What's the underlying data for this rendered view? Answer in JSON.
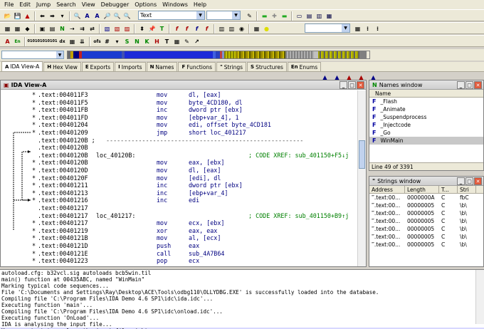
{
  "menu": [
    "File",
    "Edit",
    "Jump",
    "Search",
    "View",
    "Debugger",
    "Options",
    "Windows",
    "Help"
  ],
  "toolbar": {
    "text_combo": "Text"
  },
  "tabs": [
    {
      "icon": "A",
      "label": "IDA View-A",
      "active": true
    },
    {
      "icon": "H",
      "label": "Hex View"
    },
    {
      "icon": "E",
      "label": "Exports"
    },
    {
      "icon": "I",
      "label": "Imports"
    },
    {
      "icon": "N",
      "label": "Names"
    },
    {
      "icon": "F",
      "label": "Functions"
    },
    {
      "icon": "\"",
      "label": "Strings"
    },
    {
      "icon": "S",
      "label": "Structures"
    },
    {
      "icon": "En",
      "label": "Enums"
    }
  ],
  "ida_view": {
    "title": "IDA View-A",
    "rows": [
      {
        "dot": "*",
        "addr": ".text:004011F3",
        "label": "",
        "mnem": "mov",
        "ops": "dl, [eax]",
        "comment": ""
      },
      {
        "dot": "*",
        "addr": ".text:004011F5",
        "label": "",
        "mnem": "mov",
        "ops": "byte_4CD180, dl",
        "comment": ""
      },
      {
        "dot": "*",
        "addr": ".text:004011FB",
        "label": "",
        "mnem": "inc",
        "ops": "dword ptr [ebx]",
        "comment": ""
      },
      {
        "dot": "*",
        "addr": ".text:004011FD",
        "label": "",
        "mnem": "mov",
        "ops": "[ebp+var_4], 1",
        "comment": ""
      },
      {
        "dot": "*",
        "addr": ".text:00401204",
        "label": "",
        "mnem": "mov",
        "ops": "edi, offset byte_4CD181",
        "comment": ""
      },
      {
        "dot": "*",
        "addr": ".text:00401209",
        "label": "",
        "mnem": "jmp",
        "ops": "short loc_401217",
        "comment": ""
      },
      {
        "dot": "",
        "addr": ".text:0040120B ;",
        "label": "",
        "mnem": "",
        "ops": "",
        "comment": "",
        "sep": "-------------------------------------------------------"
      },
      {
        "dot": "",
        "addr": ".text:0040120B",
        "label": "",
        "mnem": "",
        "ops": "",
        "comment": ""
      },
      {
        "dot": "",
        "addr": ".text:0040120B",
        "label": "loc_40120B:",
        "mnem": "",
        "ops": "",
        "comment": "; CODE XREF: sub_401150+F5↓j"
      },
      {
        "dot": "*",
        "addr": ".text:0040120B",
        "label": "",
        "mnem": "mov",
        "ops": "eax, [ebx]",
        "comment": ""
      },
      {
        "dot": "*",
        "addr": ".text:0040120D",
        "label": "",
        "mnem": "mov",
        "ops": "dl, [eax]",
        "comment": ""
      },
      {
        "dot": "*",
        "addr": ".text:0040120F",
        "label": "",
        "mnem": "mov",
        "ops": "[edi], dl",
        "comment": ""
      },
      {
        "dot": "*",
        "addr": ".text:00401211",
        "label": "",
        "mnem": "inc",
        "ops": "dword ptr [ebx]",
        "comment": ""
      },
      {
        "dot": "*",
        "addr": ".text:00401213",
        "label": "",
        "mnem": "inc",
        "ops": "[ebp+var_4]",
        "comment": ""
      },
      {
        "dot": "*",
        "addr": ".text:00401216",
        "label": "",
        "mnem": "inc",
        "ops": "edi",
        "comment": ""
      },
      {
        "dot": "",
        "addr": ".text:00401217",
        "label": "",
        "mnem": "",
        "ops": "",
        "comment": ""
      },
      {
        "dot": "",
        "addr": ".text:00401217",
        "label": "loc_401217:",
        "mnem": "",
        "ops": "",
        "comment": "; CODE XREF: sub_401150+B9↑j"
      },
      {
        "dot": "*",
        "addr": ".text:00401217",
        "label": "",
        "mnem": "mov",
        "ops": "ecx, [ebx]",
        "comment": ""
      },
      {
        "dot": "*",
        "addr": ".text:00401219",
        "label": "",
        "mnem": "xor",
        "ops": "eax, eax",
        "comment": ""
      },
      {
        "dot": "*",
        "addr": ".text:0040121B",
        "label": "",
        "mnem": "mov",
        "ops": "al, [ecx]",
        "comment": ""
      },
      {
        "dot": "*",
        "addr": ".text:0040121D",
        "label": "",
        "mnem": "push",
        "ops": "eax",
        "comment": ""
      },
      {
        "dot": "*",
        "addr": ".text:0040121E",
        "label": "",
        "mnem": "call",
        "ops": "sub_4A7B64",
        "comment": ""
      },
      {
        "dot": "*",
        "addr": ".text:00401223",
        "label": "",
        "mnem": "pop",
        "ops": "ecx",
        "comment": ""
      }
    ]
  },
  "names_window": {
    "title": "Names window",
    "column": "Name",
    "items": [
      {
        "icon": "F",
        "name": "_Flash"
      },
      {
        "icon": "F",
        "name": "_Animate"
      },
      {
        "icon": "F",
        "name": "_Suspendprocess"
      },
      {
        "icon": "F",
        "name": "_Injectcode"
      },
      {
        "icon": "F",
        "name": "_Go"
      },
      {
        "icon": "F",
        "name": "WinMain",
        "selected": true
      }
    ],
    "status": "Line 49 of 3391"
  },
  "strings_window": {
    "title": "Strings window",
    "columns": [
      "Address",
      "Length",
      "T...",
      "Stri"
    ],
    "rows": [
      [
        ".text:00...",
        "0000000A",
        "C",
        "fbC"
      ],
      [
        ".text:00...",
        "00000005",
        "C",
        "\\b\\"
      ],
      [
        ".text:00...",
        "00000005",
        "C",
        "\\b\\"
      ],
      [
        ".text:00...",
        "00000005",
        "C",
        "\\b\\"
      ],
      [
        ".text:00...",
        "00000005",
        "C",
        "\\b\\"
      ],
      [
        ".text:00...",
        "00000005",
        "C",
        "\\b\\"
      ],
      [
        ".text:00...",
        "00000005",
        "C",
        "\\b\\"
      ]
    ]
  },
  "output": [
    "autoload.cfg: b32vcl.sig autoloads bcb5win.til",
    "main() function at 00435ABC, named \"WinMain\"",
    "Marking typical code sequences...",
    "File 'C:\\Documents and Settings\\Ray\\Desktop\\ACE\\Tools\\odbg110\\OLLYDBG.EXE' is successfully loaded into the database.",
    "Compiling file 'C:\\Program Files\\IDA Demo 4.6 SP1\\idc\\ida.idc'...",
    "Executing function 'main'...",
    "Compiling file 'C:\\Program Files\\IDA Demo 4.6 SP1\\idc\\onload.idc'...",
    "Executing function 'OnLoad'...",
    "IDA is analysing the input file...",
    "You may start to explore the input file right now."
  ],
  "colors": {
    "accent": "#000080",
    "comment": "#008000",
    "selection": "#d8d8ff"
  }
}
